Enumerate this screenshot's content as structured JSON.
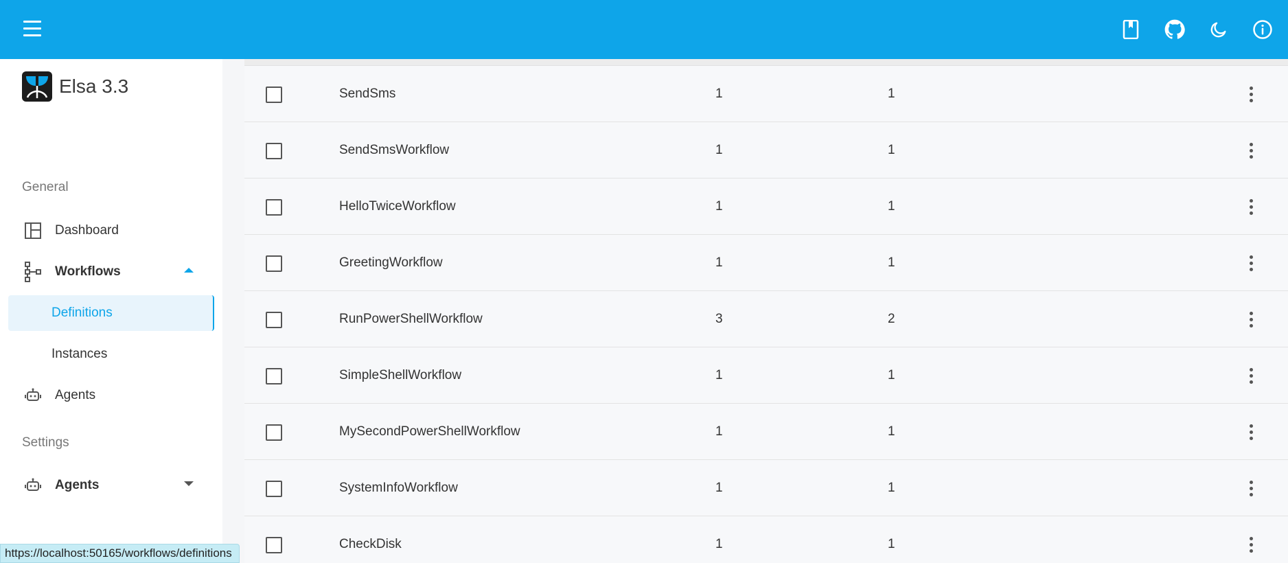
{
  "appbar": {
    "menu_icon": "hamburger-icon",
    "actions": [
      {
        "name": "docs-button",
        "icon": "bookmark-book-icon"
      },
      {
        "name": "github-button",
        "icon": "github-icon"
      },
      {
        "name": "theme-toggle-button",
        "icon": "moon-icon"
      },
      {
        "name": "info-button",
        "icon": "info-icon"
      }
    ],
    "color": "#0ea5e9"
  },
  "sidebar": {
    "brand": "Elsa 3.3",
    "sections": {
      "general": "General",
      "settings": "Settings"
    },
    "items": {
      "dashboard": "Dashboard",
      "workflows": "Workflows",
      "definitions": "Definitions",
      "instances": "Instances",
      "agents": "Agents",
      "settings_agents": "Agents"
    }
  },
  "table": {
    "rows": [
      {
        "name": "SendSms",
        "c1": "1",
        "c2": "1"
      },
      {
        "name": "SendSmsWorkflow",
        "c1": "1",
        "c2": "1"
      },
      {
        "name": "HelloTwiceWorkflow",
        "c1": "1",
        "c2": "1"
      },
      {
        "name": "GreetingWorkflow",
        "c1": "1",
        "c2": "1"
      },
      {
        "name": "RunPowerShellWorkflow",
        "c1": "3",
        "c2": "2"
      },
      {
        "name": "SimpleShellWorkflow",
        "c1": "1",
        "c2": "1"
      },
      {
        "name": "MySecondPowerShellWorkflow",
        "c1": "1",
        "c2": "1"
      },
      {
        "name": "SystemInfoWorkflow",
        "c1": "1",
        "c2": "1"
      },
      {
        "name": "CheckDisk",
        "c1": "1",
        "c2": "1"
      }
    ]
  },
  "statusbar": {
    "url": "https://localhost:50165/workflows/definitions"
  }
}
